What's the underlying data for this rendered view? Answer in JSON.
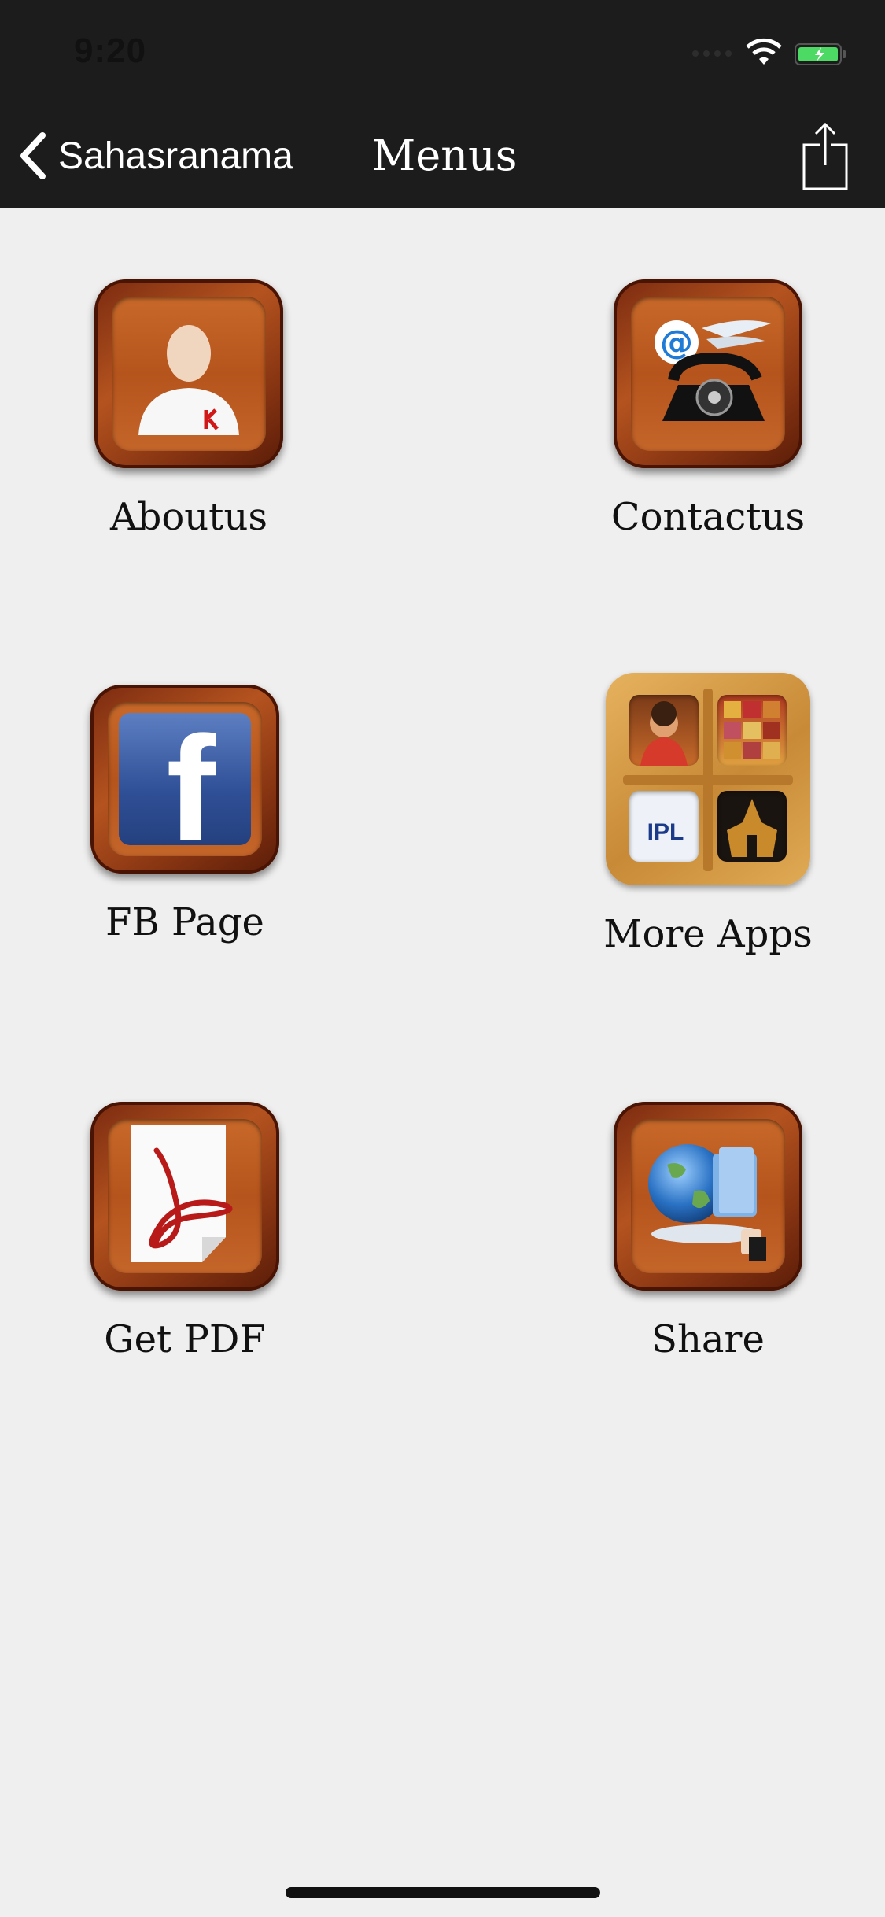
{
  "status_bar": {
    "time": "9:20"
  },
  "nav": {
    "back_label": "Sahasranama",
    "title": "Menus"
  },
  "tiles": [
    {
      "label": "Aboutus"
    },
    {
      "label": "Contactus"
    },
    {
      "label": "FB Page"
    },
    {
      "label": "More Apps"
    },
    {
      "label": "Get PDF"
    },
    {
      "label": "Share"
    }
  ],
  "icons": {
    "aboutus": "person-icon",
    "contactus": "telephone-icon",
    "fb": "facebook-icon",
    "more_apps": "app-shelf-icon",
    "pdf": "pdf-icon",
    "share": "globe-share-icon"
  },
  "fb_letter": "f",
  "ipl_text": "IPL",
  "colors": {
    "nav_bg": "#1c1c1c",
    "page_bg": "#efefef",
    "tile_wood": "#b5541c",
    "battery_green": "#4cd964"
  }
}
